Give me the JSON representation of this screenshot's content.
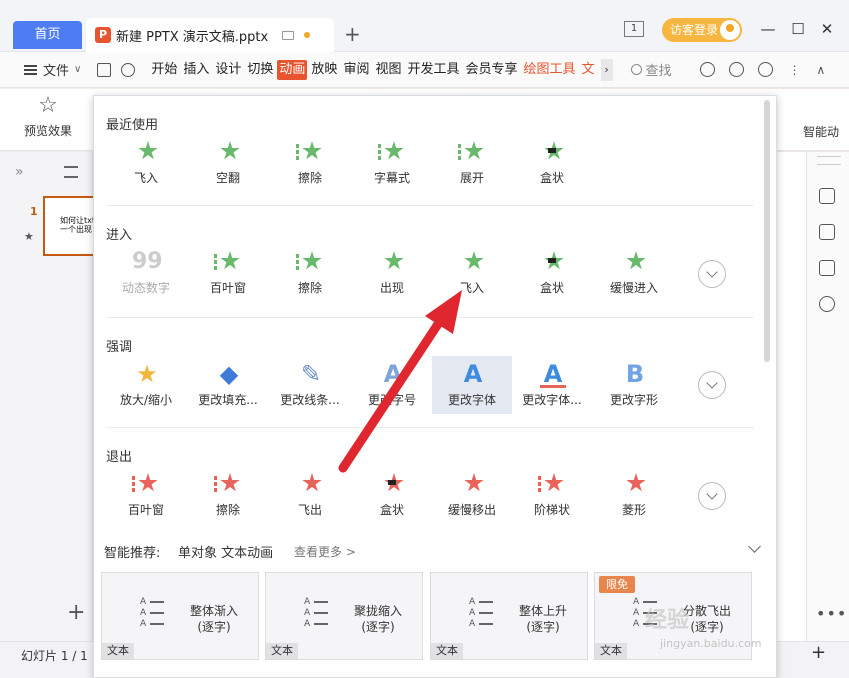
{
  "titlebar": {
    "home_tab": "首页",
    "doc_title": "新建 PPTX 演示文稿.pptx",
    "window_number": "1",
    "login_label": "访客登录"
  },
  "menubar": {
    "file_label": "文件",
    "tabs": [
      {
        "label": "开始",
        "state": "normal"
      },
      {
        "label": "插入",
        "state": "normal"
      },
      {
        "label": "设计",
        "state": "normal"
      },
      {
        "label": "切换",
        "state": "normal"
      },
      {
        "label": "动画",
        "state": "active"
      },
      {
        "label": "放映",
        "state": "normal"
      },
      {
        "label": "审阅",
        "state": "normal"
      },
      {
        "label": "视图",
        "state": "normal"
      },
      {
        "label": "开发工具",
        "state": "normal"
      },
      {
        "label": "会员专享",
        "state": "normal"
      },
      {
        "label": "绘图工具",
        "state": "orange"
      },
      {
        "label": "文",
        "state": "orange"
      }
    ],
    "search_label": "查找"
  },
  "ribbon": {
    "preview_label": "预览效果",
    "smart_label": "智能动"
  },
  "slide_pane": {
    "slide_number": "1",
    "thumb_text_line1": "如何让txt",
    "thumb_text_line2": "一个出现"
  },
  "panel": {
    "sections": [
      {
        "title": "最近使用",
        "items": [
          "飞入",
          "空翻",
          "擦除",
          "字幕式",
          "展开",
          "盒状"
        ]
      },
      {
        "title": "进入",
        "items": [
          "动态数字",
          "百叶窗",
          "擦除",
          "出现",
          "飞入",
          "盒状",
          "缓慢进入"
        ]
      },
      {
        "title": "强调",
        "items": [
          "放大/缩小",
          "更改填充...",
          "更改线条...",
          "更改字号",
          "更改字体",
          "更改字体...",
          "更改字形"
        ]
      },
      {
        "title": "退出",
        "items": [
          "百叶窗",
          "擦除",
          "飞出",
          "盒状",
          "缓慢移出",
          "阶梯状",
          "菱形"
        ]
      }
    ],
    "smart": {
      "title": "智能推荐:",
      "subtitle": "单对象 文本动画",
      "more": "查看更多 >"
    },
    "cards": [
      {
        "title": "整体渐入",
        "subtitle": "(逐字)",
        "tag": "文本",
        "badge": ""
      },
      {
        "title": "聚拢缩入",
        "subtitle": "(逐字)",
        "tag": "文本",
        "badge": ""
      },
      {
        "title": "整体上升",
        "subtitle": "(逐字)",
        "tag": "文本",
        "badge": ""
      },
      {
        "title": "分散飞出",
        "subtitle": "(逐字)",
        "tag": "文本",
        "badge": "限免"
      }
    ]
  },
  "statusbar": {
    "slide_info": "幻灯片 1 / 1"
  },
  "watermark": {
    "main": "经验",
    "sub": "jingyan.baidu.com"
  },
  "colors": {
    "accent_blue": "#4d7cf3",
    "accent_orange": "#e8542d",
    "anim_green": "#69b96d",
    "anim_red": "#e8645b",
    "arrow_red": "#e0262f"
  }
}
